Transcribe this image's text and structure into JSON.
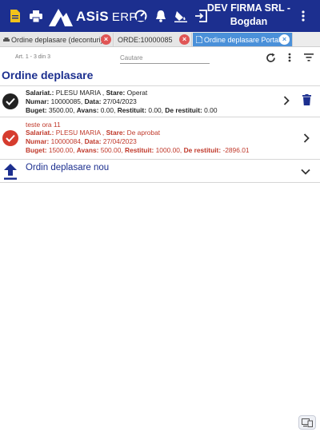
{
  "topbar": {
    "logo_text": "ASiS",
    "logo_suffix": "ERP",
    "company_line1": "DEV FIRMA SRL -",
    "company_line2": "Bogdan",
    "icons": [
      "document-icon",
      "print-icon",
      "dashboard-icon",
      "bell-icon",
      "paint-icon",
      "logout-icon",
      "more-vert-icon"
    ]
  },
  "tabs": [
    {
      "label": "Ordine deplasare (deconturi)",
      "active": false
    },
    {
      "label": "ORDE:10000085",
      "active": false
    },
    {
      "label": "Ordine deplasare Portal",
      "active": true
    }
  ],
  "toolbar": {
    "records": "Art. 1 - 3 din 3",
    "search_placeholder": "Cautare"
  },
  "page_title": "Ordine deplasare",
  "rows": [
    {
      "title": "",
      "salariat_label": "Salariat.:",
      "salariat": "PLESU MARIA",
      "stare_label": "Stare:",
      "stare": "Operat",
      "numar_label": "Numar:",
      "numar": "10000085",
      "data_label": "Data:",
      "data": "27/04/2023",
      "buget_label": "Buget:",
      "buget": "3500.00",
      "avans_label": "Avans:",
      "avans": "0.00",
      "restituit_label": "Restituit:",
      "restituit": "0.00",
      "derest_label": "De restituit:",
      "derest": "0.00",
      "status_color": "#222222"
    },
    {
      "title": "teste ora 11",
      "salariat_label": "Salariat.:",
      "salariat": "PLESU MARIA",
      "stare_label": "Stare:",
      "stare": "De aprobat",
      "numar_label": "Numar:",
      "numar": "10000084",
      "data_label": "Data:",
      "data": "27/04/2023",
      "buget_label": "Buget:",
      "buget": "1500.00",
      "avans_label": "Avans:",
      "avans": "500.00",
      "restituit_label": "Restituit:",
      "restituit": "1000.00",
      "derest_label": "De restituit:",
      "derest": "-2896.01",
      "status_color": "#d63c2e"
    }
  ],
  "new_item": {
    "label": "Ordin deplasare nou"
  },
  "colors": {
    "brand": "#1c2f8f",
    "active_tab": "#4a90d9",
    "close_red": "#e05555"
  }
}
